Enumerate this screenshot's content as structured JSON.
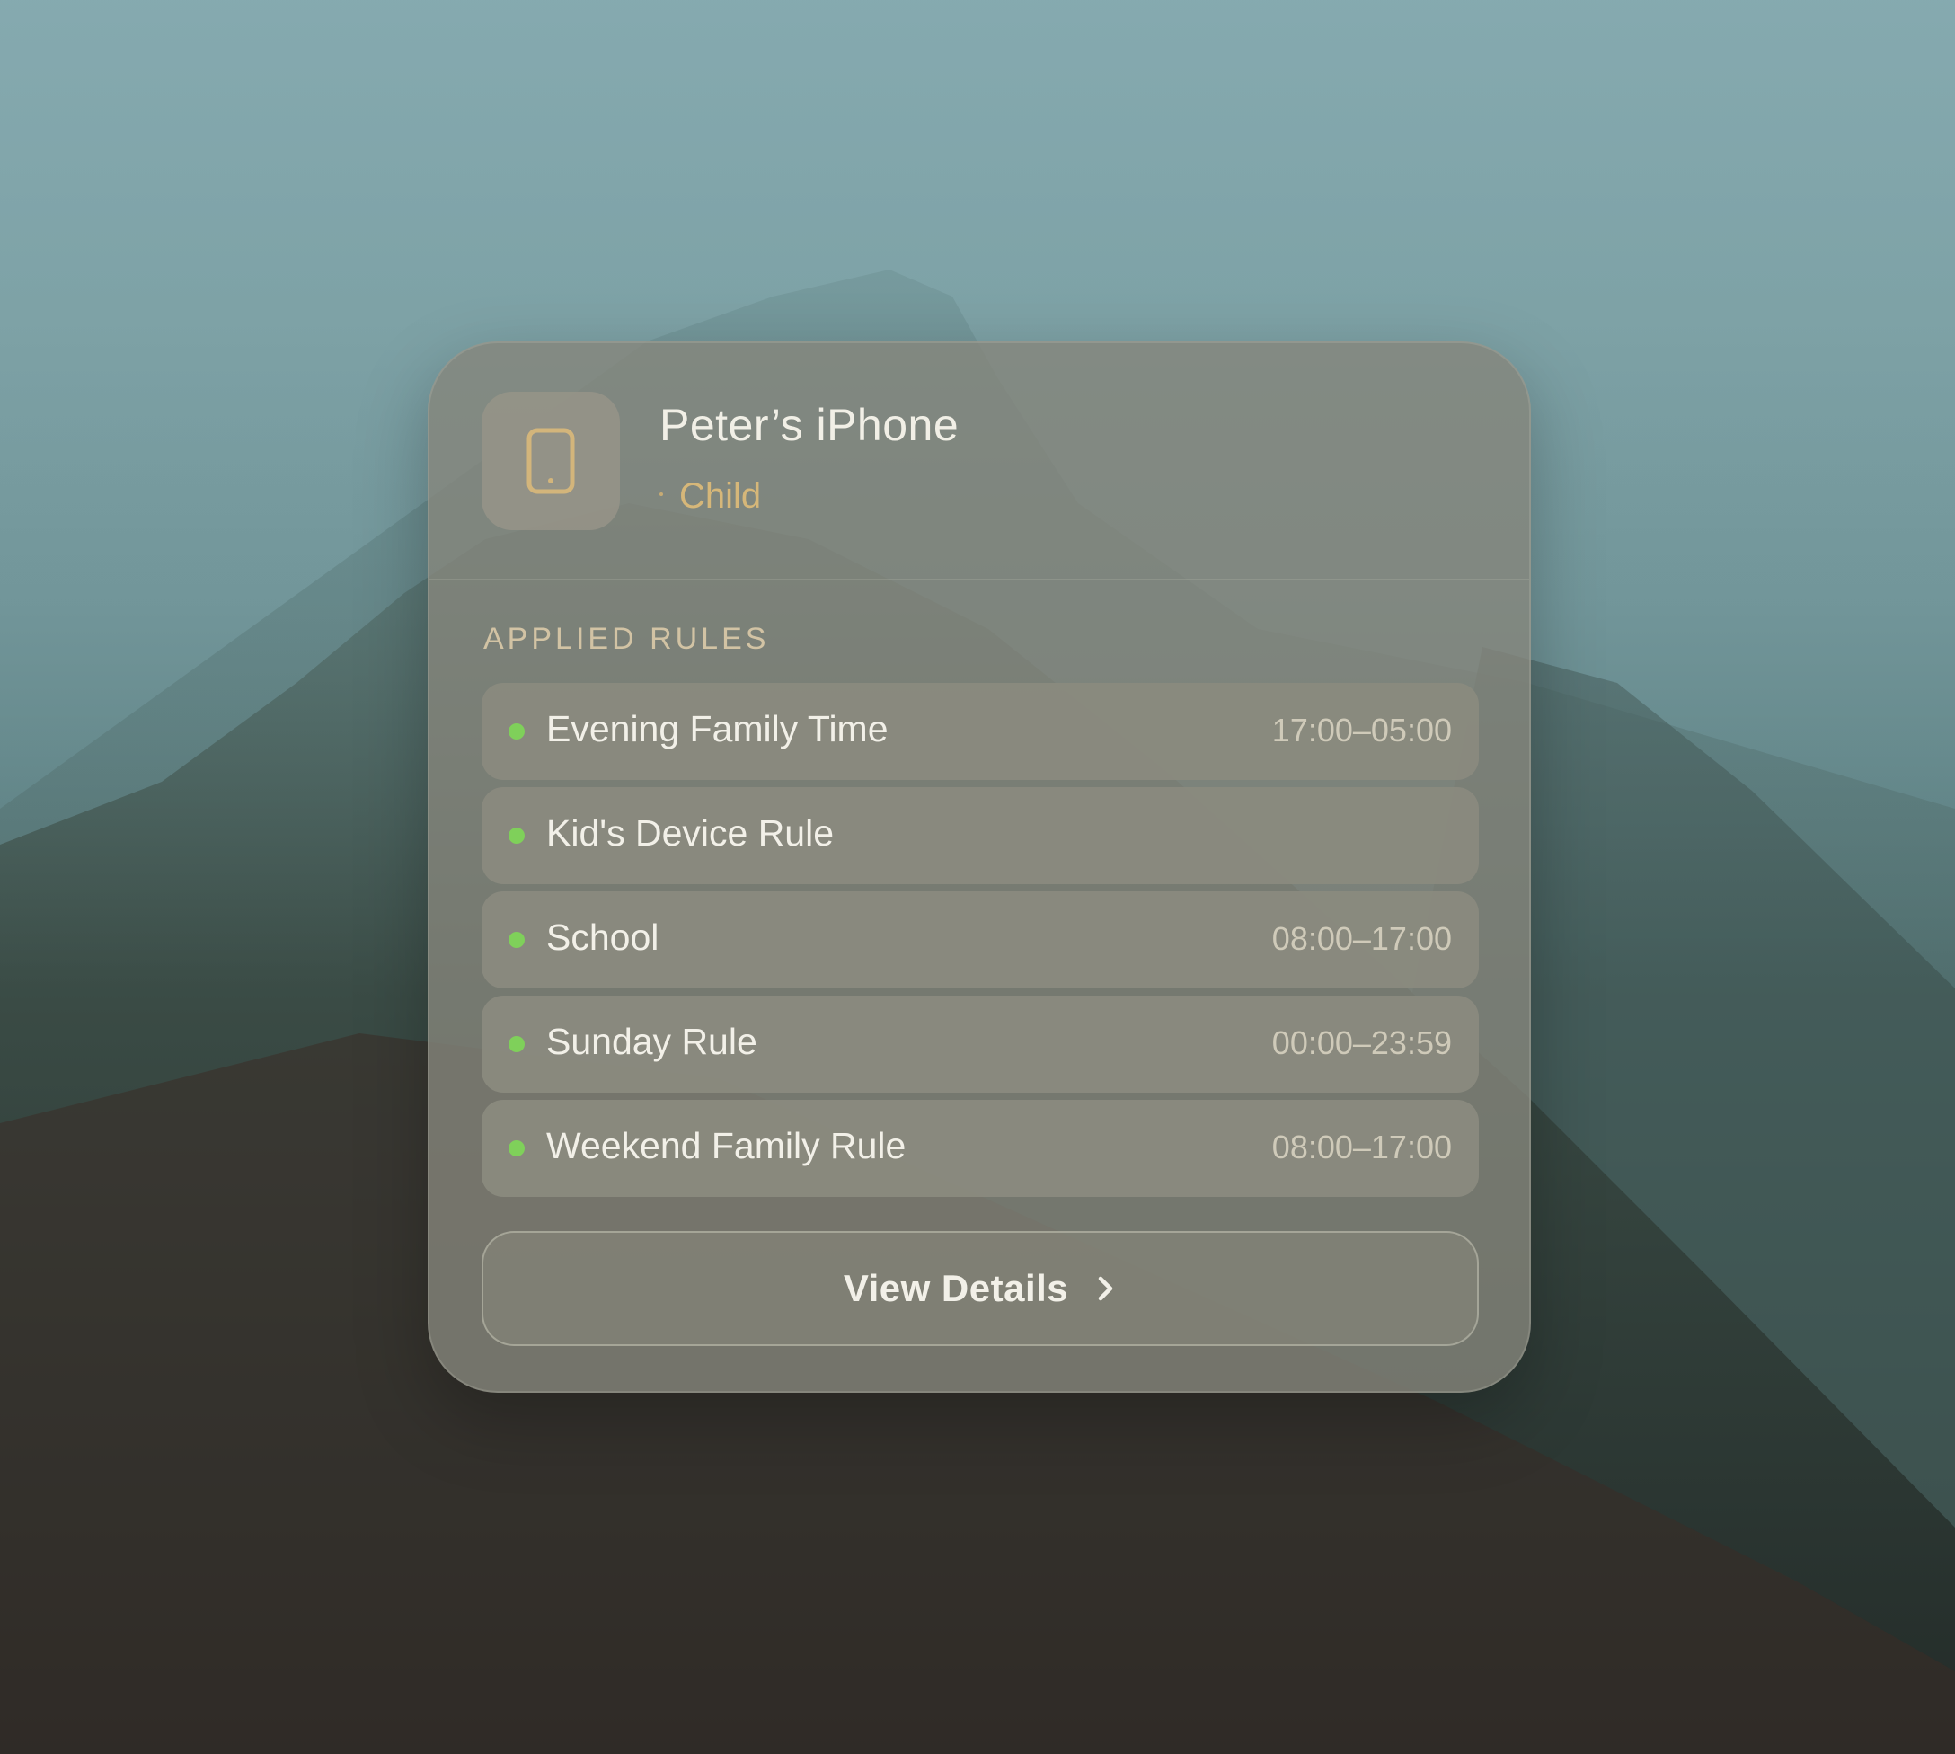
{
  "device": {
    "name": "Peter’s iPhone",
    "role": "Child",
    "icon": "phone-icon"
  },
  "rules": {
    "heading": "APPLIED RULES",
    "items": [
      {
        "name": "Evening Family Time",
        "time": "17:00–05:00",
        "status_color": "#7fd05a"
      },
      {
        "name": "Kid's Device Rule",
        "time": "",
        "status_color": "#7fd05a"
      },
      {
        "name": "School",
        "time": "08:00–17:00",
        "status_color": "#7fd05a"
      },
      {
        "name": "Sunday Rule",
        "time": "00:00–23:59",
        "status_color": "#7fd05a"
      },
      {
        "name": "Weekend Family Rule",
        "time": "08:00–17:00",
        "status_color": "#7fd05a"
      }
    ]
  },
  "actions": {
    "view_details_label": "View Details",
    "view_details_icon": "chevron-right-icon"
  },
  "colors": {
    "accent_role": "#d6b779",
    "status_active": "#7fd05a",
    "card_background": "#84847a"
  }
}
